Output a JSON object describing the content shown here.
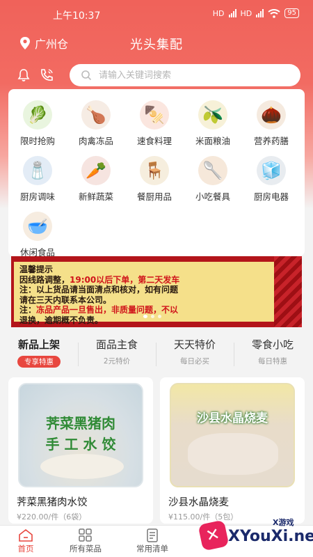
{
  "status": {
    "time": "上午10:37",
    "signal1": "HD",
    "signal2": "HD",
    "battery": "95"
  },
  "header": {
    "location": "广州仓",
    "title": "光头集配"
  },
  "search": {
    "placeholder": "请输入关键词搜索"
  },
  "categories": [
    {
      "label": "限时抢购",
      "icon": "cabbage-icon",
      "color": "#e9f5df",
      "glyph": "🥬"
    },
    {
      "label": "肉禽冻品",
      "icon": "chicken-icon",
      "color": "#f6ece4",
      "glyph": "🍗"
    },
    {
      "label": "速食料理",
      "icon": "snack-food-icon",
      "color": "#fbe6df",
      "glyph": "🍢"
    },
    {
      "label": "米面粮油",
      "icon": "oil-bottle-icon",
      "color": "#f7f1d8",
      "glyph": "🫒"
    },
    {
      "label": "营养药膳",
      "icon": "herbs-icon",
      "color": "#f5eadf",
      "glyph": "🌰"
    },
    {
      "label": "厨房调味",
      "icon": "seasoning-pack-icon",
      "color": "#e3ecf6",
      "glyph": "🧂"
    },
    {
      "label": "新鲜蔬菜",
      "icon": "vegetables-icon",
      "color": "#f6e4e0",
      "glyph": "🥕"
    },
    {
      "label": "餐厨用品",
      "icon": "chair-icon",
      "color": "#f6eede",
      "glyph": "🪑"
    },
    {
      "label": "小吃餐具",
      "icon": "utensils-icon",
      "color": "#f6e8da",
      "glyph": "🥄"
    },
    {
      "label": "厨房电器",
      "icon": "appliance-icon",
      "color": "#e8ecf0",
      "glyph": "🧊"
    },
    {
      "label": "休闲食品",
      "icon": "drink-bowl-icon",
      "color": "#f6ece0",
      "glyph": "🥣"
    }
  ],
  "banner": {
    "line1": "温馨提示",
    "line2a": "因线路调整，",
    "line2b": "19:00以后下单，第二天发车",
    "line3": "注：以上货品请当面清点和核对，如有问题",
    "line4": "请在三天内联系本公司。",
    "line5a": "注：",
    "line5b": "冻品产品一旦售出，非质量问题，不以",
    "line6": "退换，逾期概不负责。"
  },
  "tabs": [
    {
      "title": "新品上架",
      "sub": "专享特惠"
    },
    {
      "title": "面品主食",
      "sub": "2元特价"
    },
    {
      "title": "天天特价",
      "sub": "每日必买"
    },
    {
      "title": "零食小吃",
      "sub": "每日特惠"
    }
  ],
  "products": [
    {
      "name": "荠菜黑猪肉水饺",
      "price": "¥220.00/件（6袋）",
      "bag_line1": "荠菜黑猪肉",
      "bag_line2": "手 工 水 饺"
    },
    {
      "name": "沙县水晶烧麦",
      "price": "¥115.00/件（5包）",
      "bag_line1": "沙县水晶烧麦"
    }
  ],
  "tabbar": [
    {
      "label": "首页",
      "icon": "home-icon"
    },
    {
      "label": "所有菜品",
      "icon": "grid-icon"
    },
    {
      "label": "常用清单",
      "icon": "list-icon"
    }
  ],
  "watermark": {
    "text": "XYouXi.net",
    "small": "X游戏"
  },
  "colors": {
    "brand": "#f0625a",
    "accent": "#e8473f"
  }
}
